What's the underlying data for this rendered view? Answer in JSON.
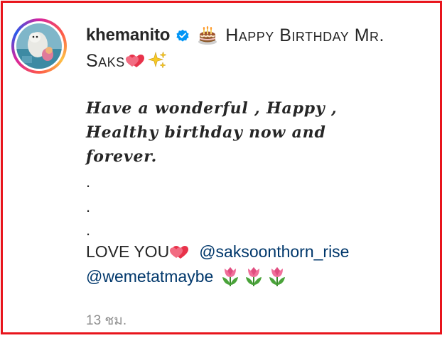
{
  "post": {
    "username": "khemanito",
    "verified": true,
    "title_line1": "Happy Birthday Mr.",
    "title_line2": "Saks",
    "italic_line1": "Have a wonderful , Happy ,",
    "italic_line2": "Healthy birthday now and",
    "italic_line3": "forever.",
    "dots": [
      ".",
      ".",
      "."
    ],
    "love_text": "LOVE YOU",
    "mention1": "@saksoonthorn_rise",
    "mention2": "@wemetatmaybe",
    "timestamp": "13 ชม."
  },
  "icons": [
    "avatar",
    "verified-badge-icon",
    "cake-emoji",
    "two-hearts-emoji",
    "sparkles-emoji",
    "tulip-emoji"
  ],
  "colors": {
    "frame": "#e8141c",
    "verified": "#0095f6",
    "mention": "#00376b",
    "timestamp": "#8e8e8e"
  }
}
